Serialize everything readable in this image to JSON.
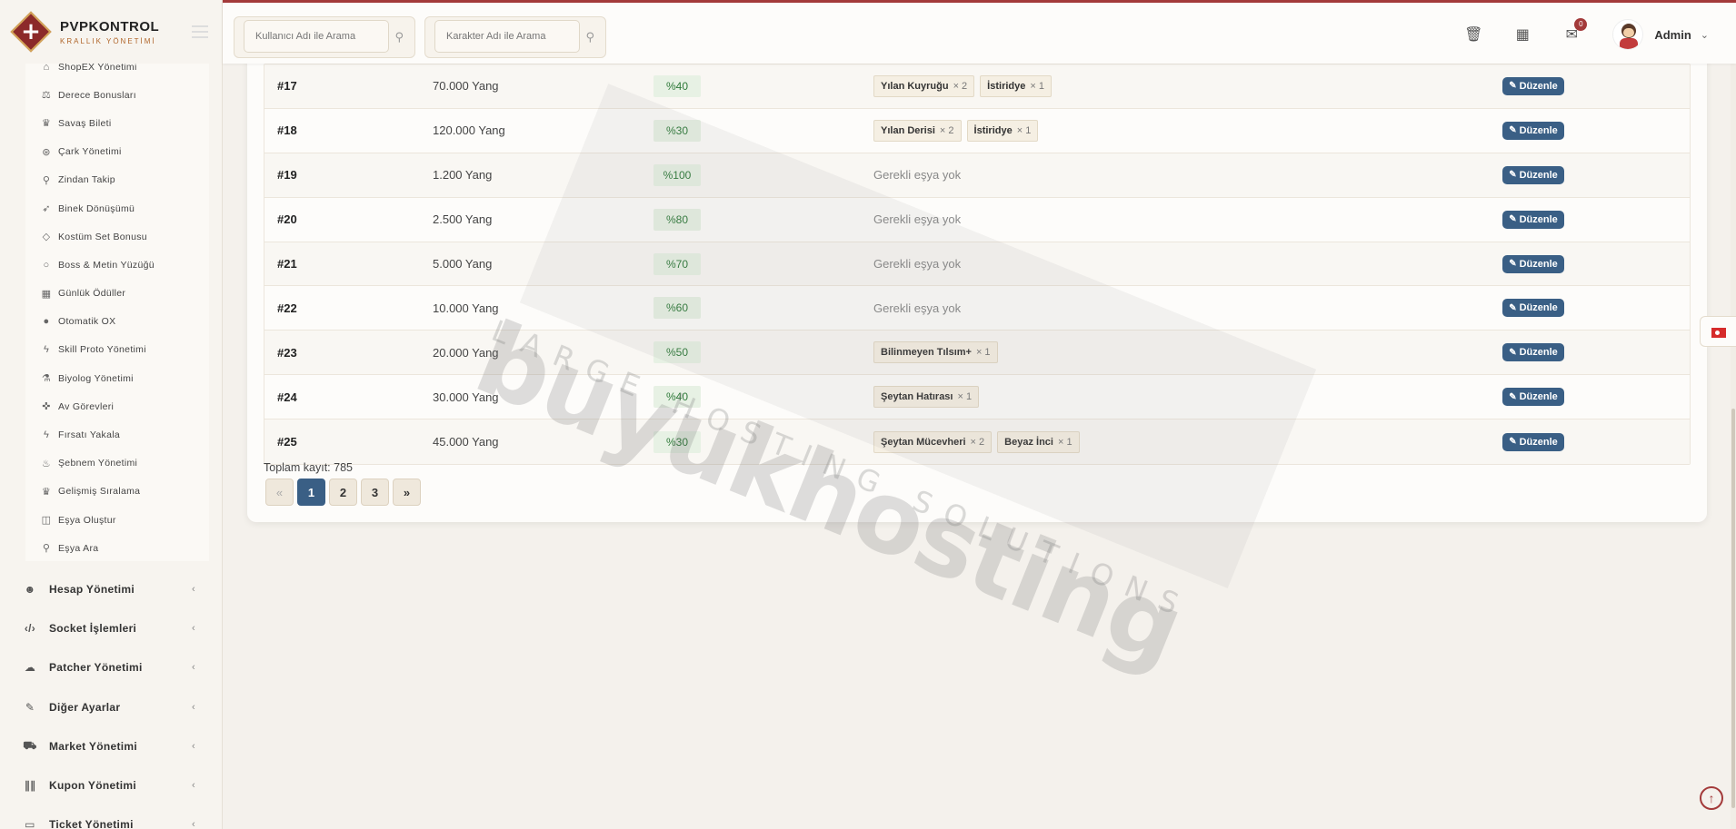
{
  "brand": {
    "title": "PVPKONTROL",
    "subtitle": "KRALLIK YÖNETİMİ"
  },
  "topbar": {
    "user_search_placeholder": "Kullanıcı Adı ile Arama",
    "char_search_placeholder": "Karakter Adı ile Arama",
    "notification_count": "0",
    "admin_name": "Admin"
  },
  "submenu": [
    {
      "label": "ShopEX Yönetimi",
      "icon": "store-icon"
    },
    {
      "label": "Derece Bonusları",
      "icon": "scale-icon"
    },
    {
      "label": "Savaş Bileti",
      "icon": "trophy-icon"
    },
    {
      "label": "Çark Yönetimi",
      "icon": "wheel-icon"
    },
    {
      "label": "Zindan Takip",
      "icon": "location-pin-icon"
    },
    {
      "label": "Binek Dönüşümü",
      "icon": "rocket-icon"
    },
    {
      "label": "Kostüm Set Bonusu",
      "icon": "gem-icon"
    },
    {
      "label": "Boss & Metin Yüzüğü",
      "icon": "ring-icon"
    },
    {
      "label": "Günlük Ödüller",
      "icon": "calendar-icon"
    },
    {
      "label": "Otomatik OX",
      "icon": "question-circle-icon"
    },
    {
      "label": "Skill Proto Yönetimi",
      "icon": "bolt-icon"
    },
    {
      "label": "Biyolog Yönetimi",
      "icon": "flask-icon"
    },
    {
      "label": "Av Görevleri",
      "icon": "crosshair-icon"
    },
    {
      "label": "Fırsatı Yakala",
      "icon": "bolt-icon"
    },
    {
      "label": "Şebnem Yönetimi",
      "icon": "flame-icon"
    },
    {
      "label": "Gelişmiş Sıralama",
      "icon": "trophy-icon"
    },
    {
      "label": "Eşya Oluştur",
      "icon": "cube-icon"
    },
    {
      "label": "Eşya Ara",
      "icon": "search-icon"
    }
  ],
  "main_menu": [
    {
      "label": "Hesap Yönetimi",
      "icon": "users-icon"
    },
    {
      "label": "Socket İşlemleri",
      "icon": "code-icon"
    },
    {
      "label": "Patcher Yönetimi",
      "icon": "cloud-upload-icon"
    },
    {
      "label": "Diğer Ayarlar",
      "icon": "wrench-icon"
    },
    {
      "label": "Market Yönetimi",
      "icon": "cart-icon"
    },
    {
      "label": "Kupon Yönetimi",
      "icon": "barcode-icon"
    },
    {
      "label": "Ticket Yönetimi",
      "icon": "ticket-icon"
    }
  ],
  "table": {
    "no_items_text": "Gerekli eşya yok",
    "edit_label": "Düzenle",
    "rows": [
      {
        "id": "#17",
        "price": "70.000 Yang",
        "rate": "%40",
        "items": [
          {
            "name": "Yılan Kuyruğu",
            "qty": "× 2"
          },
          {
            "name": "İstiridye",
            "qty": "× 1"
          }
        ]
      },
      {
        "id": "#18",
        "price": "120.000 Yang",
        "rate": "%30",
        "items": [
          {
            "name": "Yılan Derisi",
            "qty": "× 2"
          },
          {
            "name": "İstiridye",
            "qty": "× 1"
          }
        ]
      },
      {
        "id": "#19",
        "price": "1.200 Yang",
        "rate": "%100",
        "items": []
      },
      {
        "id": "#20",
        "price": "2.500 Yang",
        "rate": "%80",
        "items": []
      },
      {
        "id": "#21",
        "price": "5.000 Yang",
        "rate": "%70",
        "items": []
      },
      {
        "id": "#22",
        "price": "10.000 Yang",
        "rate": "%60",
        "items": []
      },
      {
        "id": "#23",
        "price": "20.000 Yang",
        "rate": "%50",
        "items": [
          {
            "name": "Bilinmeyen Tılsım+",
            "qty": "× 1"
          }
        ]
      },
      {
        "id": "#24",
        "price": "30.000 Yang",
        "rate": "%40",
        "items": [
          {
            "name": "Şeytan Hatırası",
            "qty": "× 1"
          }
        ]
      },
      {
        "id": "#25",
        "price": "45.000 Yang",
        "rate": "%30",
        "items": [
          {
            "name": "Şeytan Mücevheri",
            "qty": "× 2"
          },
          {
            "name": "Beyaz İnci",
            "qty": "× 1"
          }
        ]
      }
    ]
  },
  "total_text": "Toplam kayıt: 785",
  "pagination": {
    "prev": "«",
    "pages": [
      "1",
      "2",
      "3"
    ],
    "current": "1",
    "next": "»"
  },
  "watermark": {
    "big": "buyukhosting",
    "small": "LARGE HOSTING SOLUTIONS"
  },
  "colors": {
    "accent": "#a33a3a",
    "primary_button": "#3a5f85",
    "rate_bg": "#e7f1e4",
    "rate_text": "#2f7a3a"
  }
}
